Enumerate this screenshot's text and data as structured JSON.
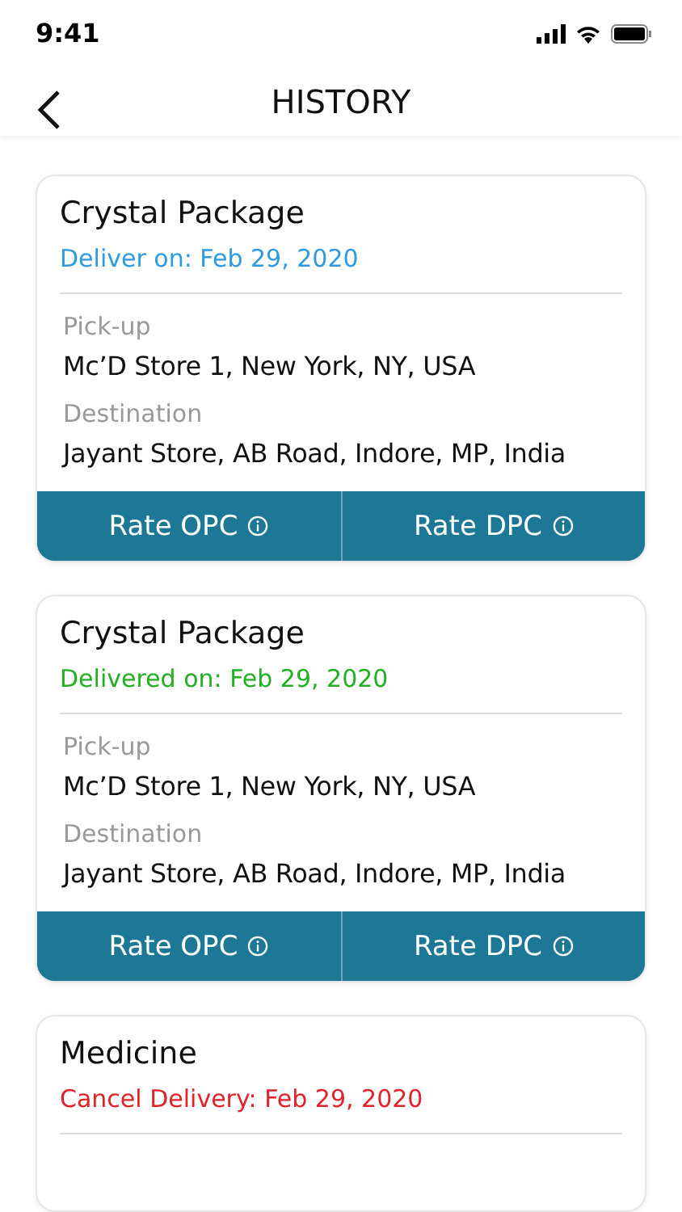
{
  "status_bar": {
    "time": "9:41"
  },
  "header": {
    "title": "HISTORY"
  },
  "orders": [
    {
      "name": "Crystal Package",
      "status": "Deliver on: Feb 29, 2020",
      "color": "#2d9be0",
      "stops": [
        {
          "label": "Pick-up",
          "value": "Mc’D Store 1, New York, NY, USA"
        },
        {
          "label": "Destination",
          "value": "Jayant Store, AB Road, Indore, MP, India"
        }
      ],
      "actions": [
        "Rate OPC",
        "Rate DPC"
      ]
    },
    {
      "name": "Crystal Package",
      "status": "Delivered on: Feb 29, 2020",
      "color": "#22b022",
      "stops": [
        {
          "label": "Pick-up",
          "value": "Mc’D Store 1, New York, NY, USA"
        },
        {
          "label": "Destination",
          "value": "Jayant Store, AB Road, Indore, MP, India"
        }
      ],
      "actions": [
        "Rate OPC",
        "Rate DPC"
      ]
    },
    {
      "name": "Medicine",
      "status": "Cancel Delivery: Feb 29, 2020",
      "color": "#e0222a"
    }
  ]
}
